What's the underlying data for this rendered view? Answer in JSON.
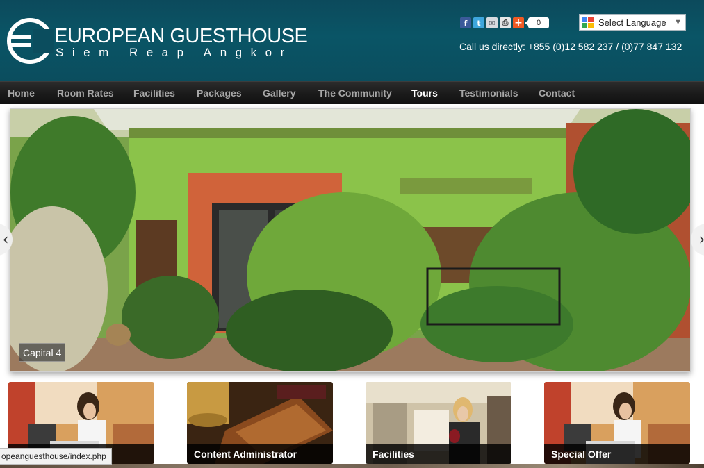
{
  "header": {
    "brand_name": "EUROPEAN GUESTHOUSE",
    "brand_sub": "Siem Reap Angkor",
    "phone": "Call us directly: +855 (0)12 582 237 / (0)77 847 132",
    "share": {
      "icons": [
        "facebook-icon",
        "twitter-icon",
        "email-icon",
        "print-icon",
        "addthis-plus-icon"
      ],
      "count": "0"
    },
    "language": {
      "label": "Select Language",
      "arrow": "▼"
    }
  },
  "nav": {
    "items": [
      {
        "label": "Home"
      },
      {
        "label": "Room Rates"
      },
      {
        "label": "Facilities"
      },
      {
        "label": "Packages"
      },
      {
        "label": "Gallery"
      },
      {
        "label": "The Community"
      },
      {
        "label": "Tours",
        "active": true
      },
      {
        "label": "Testimonials"
      },
      {
        "label": "Contact"
      }
    ]
  },
  "slider": {
    "caption": "Capital 4",
    "prev_glyph": "‹",
    "next_glyph": "›"
  },
  "tiles": [
    {
      "label": ""
    },
    {
      "label": "Content Administrator"
    },
    {
      "label": "Facilities"
    },
    {
      "label": "Special Offer"
    }
  ],
  "status_bar": {
    "url": "opeanguesthouse/index.php"
  },
  "colors": {
    "header_bg": "#0b4d5e",
    "nav_bg": "#1a1a1a",
    "nav_text": "#a7a7a7",
    "nav_active": "#ffffff"
  }
}
